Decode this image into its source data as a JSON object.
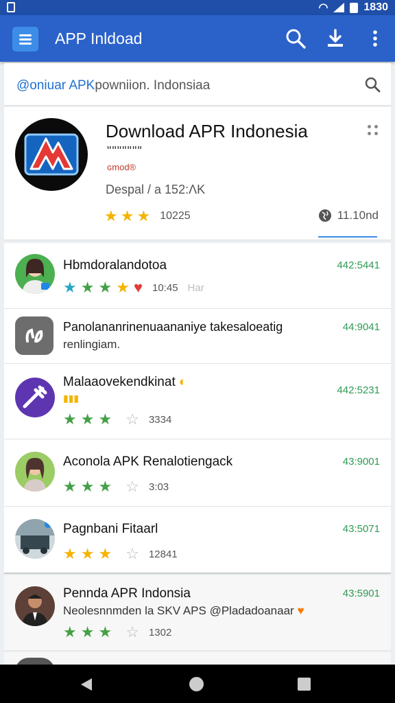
{
  "status": {
    "time": "1830"
  },
  "app_bar": {
    "title": "APP Inldoad"
  },
  "search": {
    "prefix": "@oniuar APK",
    "text": "powniion. Indonsiaa"
  },
  "hero": {
    "title": "Download APR Indonesia",
    "dots": "\"\"\"\"\"\"\"",
    "tag": "ɢmod®",
    "meta": "Despal / a 152:ΛΚ",
    "rating_count": "10225",
    "downloads": "11.10nd",
    "rating_stars": 3
  },
  "list": [
    {
      "title": "Hbmdoralandotoa",
      "number": "442:5441",
      "stars": [
        "t",
        "g",
        "g",
        "y"
      ],
      "extra": "10:45",
      "extra2": "Har"
    },
    {
      "title": "Panolananrinenuaananiye takesaloeatig",
      "subtitle": "renlingiam.",
      "number": "44:9041"
    },
    {
      "title": "Malaaovekendkinat",
      "number": "442:5231",
      "stars": [
        "g",
        "g",
        "g"
      ],
      "count": "3334"
    },
    {
      "title": "Aconola APK Renalotiengack",
      "number": "43:9001",
      "stars": [
        "g",
        "g",
        "g"
      ],
      "count": "3:03"
    },
    {
      "title": "Pagnbani Fitaarl",
      "number": "43:5071",
      "stars": [
        "y",
        "y",
        "y"
      ],
      "count": "12841"
    },
    {
      "title": "Pennda APR Indonsia",
      "subtitle": "Neolesnnmden la SKV APS @Pladadoanaar",
      "number": "43:5901",
      "stars": [
        "g",
        "g",
        "g"
      ],
      "count": "1302"
    }
  ],
  "colors": {
    "app_bar": "#2a62c9",
    "status_bar": "#1f4fa8",
    "accent": "#3d8de8",
    "rating_number": "#2e9a53"
  }
}
